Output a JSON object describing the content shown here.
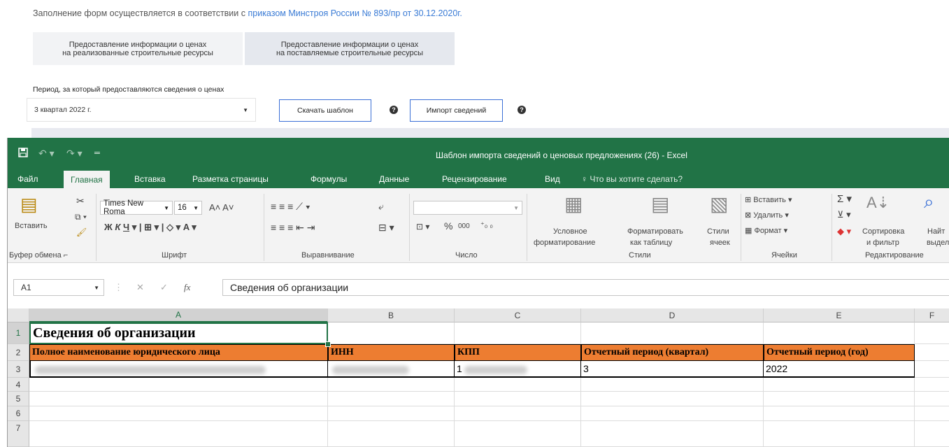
{
  "notice": {
    "text": "Заполнение форм осуществляется в соответствии с ",
    "link": "приказом Минстроя России № 893/пр от 30.12.2020г."
  },
  "tabs": [
    {
      "line1": "Предоставление информации о ценах",
      "line2": "на реализованные строительные ресурсы"
    },
    {
      "line1": "Предоставление информации о ценах",
      "line2": "на поставляемые строительные ресурсы"
    }
  ],
  "period": {
    "label": "Период, за который предоставляются сведения о ценах",
    "value": "3 квартал 2022 г."
  },
  "buttons": {
    "download": "Скачать шаблон",
    "import": "Импорт сведений",
    "help": "?"
  },
  "excel": {
    "title": "Шаблон импорта сведений о ценовых предложениях (26) - Excel",
    "menu": [
      "Файл",
      "Главная",
      "Вставка",
      "Разметка страницы",
      "Формулы",
      "Данные",
      "Рецензирование",
      "Вид"
    ],
    "tell_me": "Что вы хотите сделать?",
    "ribbon": {
      "paste": "Вставить",
      "clipboard": "Буфер обмена",
      "font_name": "Times New Roma",
      "font_size": "16",
      "font_group": "Шрифт",
      "align_group": "Выравнивание",
      "number_group": "Число",
      "percent": "%",
      "thousands": "000",
      "cond1": "Условное",
      "cond2": "форматирование",
      "fmt1": "Форматировать",
      "fmt2": "как таблицу",
      "styles1": "Стили",
      "styles2": "ячеек",
      "styles_group": "Стили",
      "insert": "Вставить",
      "delete": "Удалить",
      "format": "Формат",
      "cells_group": "Ячейки",
      "sort1": "Сортировка",
      "sort2": "и фильтр",
      "find1": "Найт",
      "find2": "выдел",
      "edit_group": "Редактирование"
    },
    "namebox": "A1",
    "formula": "Сведения об организации",
    "columns": [
      "A",
      "B",
      "C",
      "D",
      "E",
      "F"
    ],
    "rows": [
      "1",
      "2",
      "3",
      "4",
      "5",
      "6",
      "7"
    ],
    "cells": {
      "a1": "Сведения об организации",
      "a2": "Полное наименование юридического лица",
      "b2": "ИНН",
      "c2": "КПП",
      "d2": "Отчетный период (квартал)",
      "e2": "Отчетный период (год)",
      "c3": "1",
      "d3": "3",
      "e3": "2022"
    }
  }
}
